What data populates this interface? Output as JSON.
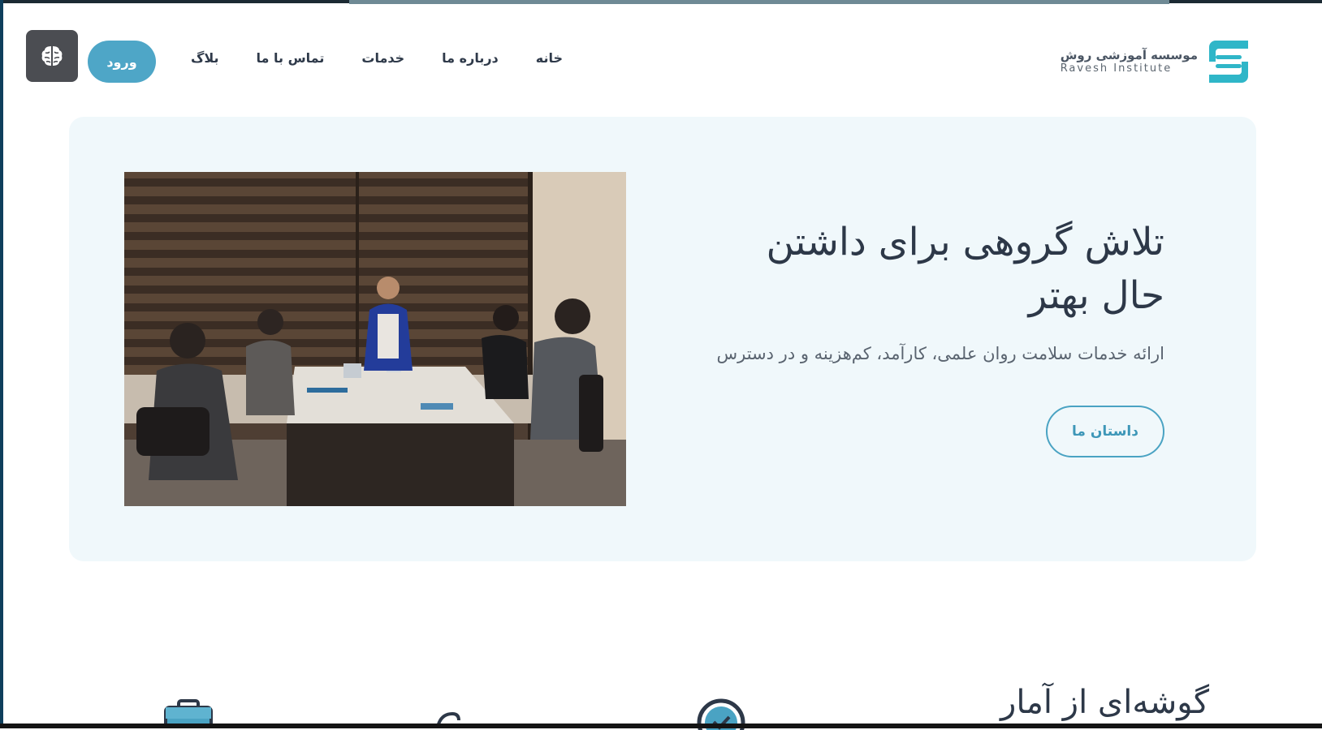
{
  "brand": {
    "name_fa": "موسسه آموزشی روش",
    "name_en": "Ravesh Institute",
    "accent": "#2fb6c8"
  },
  "nav": {
    "items": [
      {
        "label": "خانه"
      },
      {
        "label": "درباره ما"
      },
      {
        "label": "خدمات"
      },
      {
        "label": "تماس با ما"
      },
      {
        "label": "بلاگ"
      }
    ]
  },
  "header": {
    "login_label": "ورود",
    "menu_icon": "brain-icon"
  },
  "hero": {
    "title_line1": "تلاش گروهی برای داشتن",
    "title_line2": "حال بهتر",
    "subtitle": "ارائه خدمات سلامت روان علمی، کارآمد، کم‌هزینه و در دسترس",
    "cta_label": "داستان ما",
    "image_icon": "team-meeting-photo"
  },
  "stats": {
    "title": "گوشه‌ای از آمار",
    "icons": [
      "check-badge-icon",
      "pen-icon",
      "briefcase-icon"
    ]
  },
  "colors": {
    "login_bg": "#4ea6c7",
    "hero_bg": "#f0f8fb",
    "text_dark": "#2d3848",
    "cta_border": "#4aa3c3"
  }
}
